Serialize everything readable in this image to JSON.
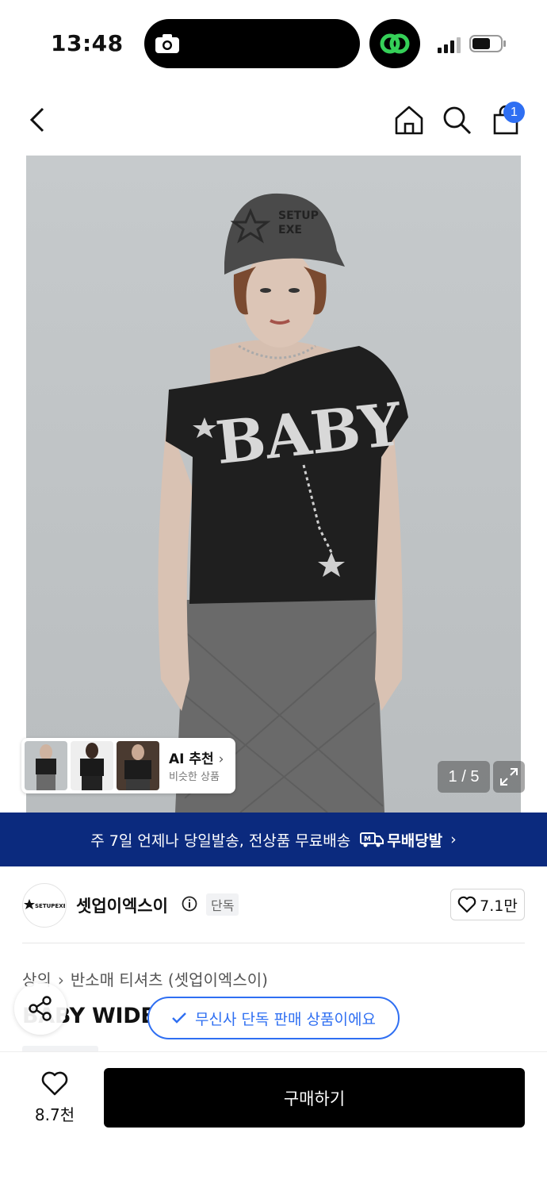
{
  "status_bar": {
    "time": "13:48"
  },
  "nav": {
    "cart_count": "1",
    "icons": [
      "back-chevron-icon",
      "home-icon",
      "search-icon",
      "shopping-bag-icon"
    ]
  },
  "hero": {
    "image_description_icon": "product-model-photo",
    "counter": "1 / 5",
    "ai": {
      "title": "AI 추천",
      "subtitle": "비슷한 상품"
    }
  },
  "banner": {
    "text": "주 7일 언제나 당일발송, 전상품 무료배송",
    "logo_text": "무배당발"
  },
  "brand": {
    "name": "셋업이엑스이",
    "badge": "단독",
    "likes": "7.1만",
    "logo_text": "SETUPEXE"
  },
  "breadcrumb": {
    "level1": "상의",
    "level2": "반소매 티셔츠 (셋업이엑스이)"
  },
  "product": {
    "title_visible": "BABY WIDE"
  },
  "exclusive_pill": "무신사 단독 판매 상품이에요",
  "bottom_bar": {
    "like_count": "8.7천",
    "buy_label": "구매하기"
  },
  "colors": {
    "accent": "#2f6ff2",
    "banner": "#0b2a7e",
    "buy": "#000000"
  }
}
